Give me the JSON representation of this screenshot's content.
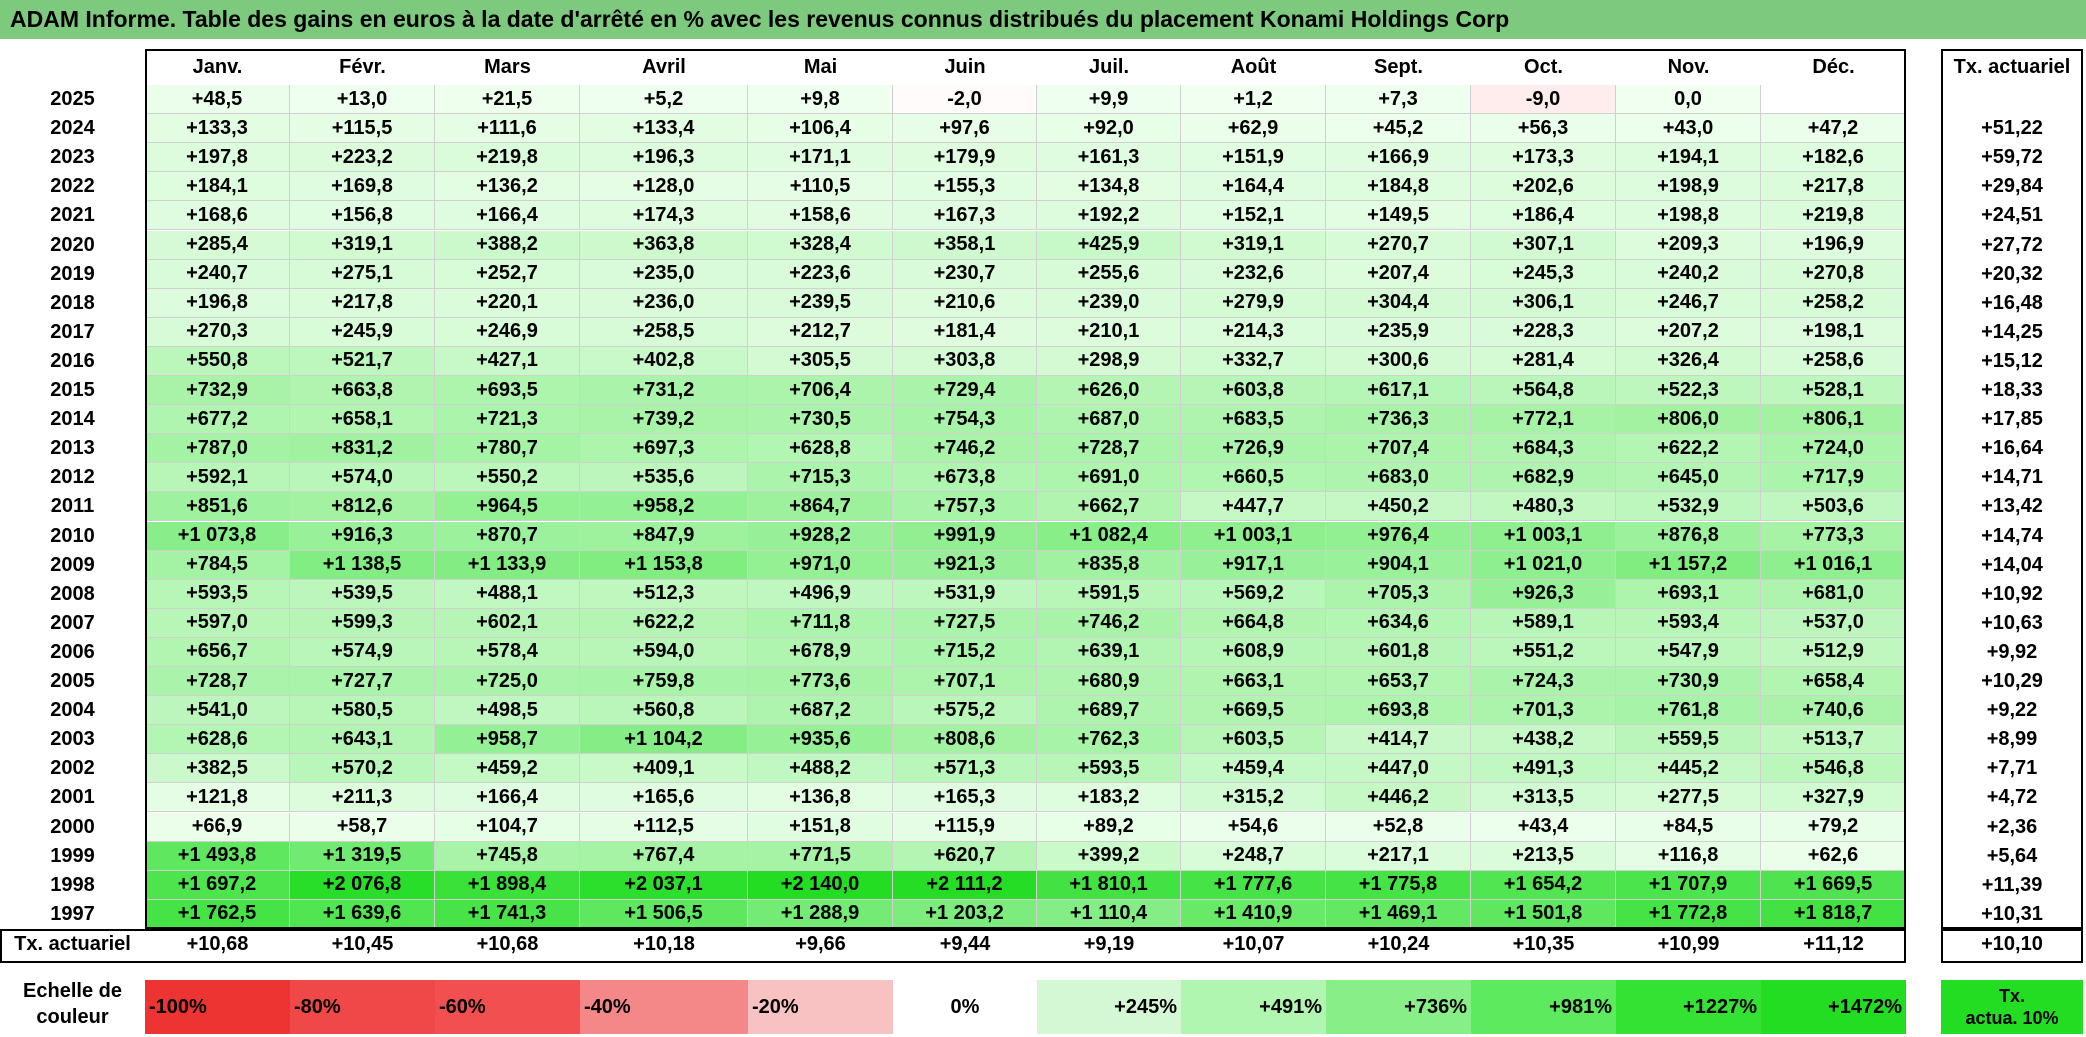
{
  "title": "ADAM Informe. Table des gains en euros à la date d'arrêté en % avec les revenus connus distribués du placement Konami Holdings Corp",
  "months": [
    "Janv.",
    "Févr.",
    "Mars",
    "Avril",
    "Mai",
    "Juin",
    "Juil.",
    "Août",
    "Sept.",
    "Oct.",
    "Nov.",
    "Déc."
  ],
  "rate_header": "Tx. actuariel",
  "bottom_row_label": "Tx. actuariel",
  "chart_data": {
    "type": "heatmap",
    "title": "ADAM Informe. Table des gains en euros à la date d'arrêté en % avec les revenus connus distribués du placement Konami Holdings Corp",
    "columns": [
      "Janv.",
      "Févr.",
      "Mars",
      "Avril",
      "Mai",
      "Juin",
      "Juil.",
      "Août",
      "Sept.",
      "Oct.",
      "Nov.",
      "Déc."
    ],
    "rows": [
      {
        "year": "2025",
        "values": [
          "+48,5",
          "+13,0",
          "+21,5",
          "+5,2",
          "+9,8",
          "-2,0",
          "+9,9",
          "+1,2",
          "+7,3",
          "-9,0",
          "0,0",
          ""
        ],
        "rate": ""
      },
      {
        "year": "2024",
        "values": [
          "+133,3",
          "+115,5",
          "+111,6",
          "+133,4",
          "+106,4",
          "+97,6",
          "+92,0",
          "+62,9",
          "+45,2",
          "+56,3",
          "+43,0",
          "+47,2"
        ],
        "rate": "+51,22"
      },
      {
        "year": "2023",
        "values": [
          "+197,8",
          "+223,2",
          "+219,8",
          "+196,3",
          "+171,1",
          "+179,9",
          "+161,3",
          "+151,9",
          "+166,9",
          "+173,3",
          "+194,1",
          "+182,6"
        ],
        "rate": "+59,72"
      },
      {
        "year": "2022",
        "values": [
          "+184,1",
          "+169,8",
          "+136,2",
          "+128,0",
          "+110,5",
          "+155,3",
          "+134,8",
          "+164,4",
          "+184,8",
          "+202,6",
          "+198,9",
          "+217,8"
        ],
        "rate": "+29,84"
      },
      {
        "year": "2021",
        "values": [
          "+168,6",
          "+156,8",
          "+166,4",
          "+174,3",
          "+158,6",
          "+167,3",
          "+192,2",
          "+152,1",
          "+149,5",
          "+186,4",
          "+198,8",
          "+219,8"
        ],
        "rate": "+24,51"
      },
      {
        "year": "2020",
        "values": [
          "+285,4",
          "+319,1",
          "+388,2",
          "+363,8",
          "+328,4",
          "+358,1",
          "+425,9",
          "+319,1",
          "+270,7",
          "+307,1",
          "+209,3",
          "+196,9"
        ],
        "rate": "+27,72"
      },
      {
        "year": "2019",
        "values": [
          "+240,7",
          "+275,1",
          "+252,7",
          "+235,0",
          "+223,6",
          "+230,7",
          "+255,6",
          "+232,6",
          "+207,4",
          "+245,3",
          "+240,2",
          "+270,8"
        ],
        "rate": "+20,32"
      },
      {
        "year": "2018",
        "values": [
          "+196,8",
          "+217,8",
          "+220,1",
          "+236,0",
          "+239,5",
          "+210,6",
          "+239,0",
          "+279,9",
          "+304,4",
          "+306,1",
          "+246,7",
          "+258,2"
        ],
        "rate": "+16,48"
      },
      {
        "year": "2017",
        "values": [
          "+270,3",
          "+245,9",
          "+246,9",
          "+258,5",
          "+212,7",
          "+181,4",
          "+210,1",
          "+214,3",
          "+235,9",
          "+228,3",
          "+207,2",
          "+198,1"
        ],
        "rate": "+14,25"
      },
      {
        "year": "2016",
        "values": [
          "+550,8",
          "+521,7",
          "+427,1",
          "+402,8",
          "+305,5",
          "+303,8",
          "+298,9",
          "+332,7",
          "+300,6",
          "+281,4",
          "+326,4",
          "+258,6"
        ],
        "rate": "+15,12"
      },
      {
        "year": "2015",
        "values": [
          "+732,9",
          "+663,8",
          "+693,5",
          "+731,2",
          "+706,4",
          "+729,4",
          "+626,0",
          "+603,8",
          "+617,1",
          "+564,8",
          "+522,3",
          "+528,1"
        ],
        "rate": "+18,33"
      },
      {
        "year": "2014",
        "values": [
          "+677,2",
          "+658,1",
          "+721,3",
          "+739,2",
          "+730,5",
          "+754,3",
          "+687,0",
          "+683,5",
          "+736,3",
          "+772,1",
          "+806,0",
          "+806,1"
        ],
        "rate": "+17,85"
      },
      {
        "year": "2013",
        "values": [
          "+787,0",
          "+831,2",
          "+780,7",
          "+697,3",
          "+628,8",
          "+746,2",
          "+728,7",
          "+726,9",
          "+707,4",
          "+684,3",
          "+622,2",
          "+724,0"
        ],
        "rate": "+16,64"
      },
      {
        "year": "2012",
        "values": [
          "+592,1",
          "+574,0",
          "+550,2",
          "+535,6",
          "+715,3",
          "+673,8",
          "+691,0",
          "+660,5",
          "+683,0",
          "+682,9",
          "+645,0",
          "+717,9"
        ],
        "rate": "+14,71"
      },
      {
        "year": "2011",
        "values": [
          "+851,6",
          "+812,6",
          "+964,5",
          "+958,2",
          "+864,7",
          "+757,3",
          "+662,7",
          "+447,7",
          "+450,2",
          "+480,3",
          "+532,9",
          "+503,6"
        ],
        "rate": "+13,42"
      },
      {
        "year": "2010",
        "values": [
          "+1 073,8",
          "+916,3",
          "+870,7",
          "+847,9",
          "+928,2",
          "+991,9",
          "+1 082,4",
          "+1 003,1",
          "+976,4",
          "+1 003,1",
          "+876,8",
          "+773,3"
        ],
        "rate": "+14,74"
      },
      {
        "year": "2009",
        "values": [
          "+784,5",
          "+1 138,5",
          "+1 133,9",
          "+1 153,8",
          "+971,0",
          "+921,3",
          "+835,8",
          "+917,1",
          "+904,1",
          "+1 021,0",
          "+1 157,2",
          "+1 016,1"
        ],
        "rate": "+14,04"
      },
      {
        "year": "2008",
        "values": [
          "+593,5",
          "+539,5",
          "+488,1",
          "+512,3",
          "+496,9",
          "+531,9",
          "+591,5",
          "+569,2",
          "+705,3",
          "+926,3",
          "+693,1",
          "+681,0"
        ],
        "rate": "+10,92"
      },
      {
        "year": "2007",
        "values": [
          "+597,0",
          "+599,3",
          "+602,1",
          "+622,2",
          "+711,8",
          "+727,5",
          "+746,2",
          "+664,8",
          "+634,6",
          "+589,1",
          "+593,4",
          "+537,0"
        ],
        "rate": "+10,63"
      },
      {
        "year": "2006",
        "values": [
          "+656,7",
          "+574,9",
          "+578,4",
          "+594,0",
          "+678,9",
          "+715,2",
          "+639,1",
          "+608,9",
          "+601,8",
          "+551,2",
          "+547,9",
          "+512,9"
        ],
        "rate": "+9,92"
      },
      {
        "year": "2005",
        "values": [
          "+728,7",
          "+727,7",
          "+725,0",
          "+759,8",
          "+773,6",
          "+707,1",
          "+680,9",
          "+663,1",
          "+653,7",
          "+724,3",
          "+730,9",
          "+658,4"
        ],
        "rate": "+10,29"
      },
      {
        "year": "2004",
        "values": [
          "+541,0",
          "+580,5",
          "+498,5",
          "+560,8",
          "+687,2",
          "+575,2",
          "+689,7",
          "+669,5",
          "+693,8",
          "+701,3",
          "+761,8",
          "+740,6"
        ],
        "rate": "+9,22"
      },
      {
        "year": "2003",
        "values": [
          "+628,6",
          "+643,1",
          "+958,7",
          "+1 104,2",
          "+935,6",
          "+808,6",
          "+762,3",
          "+603,5",
          "+414,7",
          "+438,2",
          "+559,5",
          "+513,7"
        ],
        "rate": "+8,99"
      },
      {
        "year": "2002",
        "values": [
          "+382,5",
          "+570,2",
          "+459,2",
          "+409,1",
          "+488,2",
          "+571,3",
          "+593,5",
          "+459,4",
          "+447,0",
          "+491,3",
          "+445,2",
          "+546,8"
        ],
        "rate": "+7,71"
      },
      {
        "year": "2001",
        "values": [
          "+121,8",
          "+211,3",
          "+166,4",
          "+165,6",
          "+136,8",
          "+165,3",
          "+183,2",
          "+315,2",
          "+446,2",
          "+313,5",
          "+277,5",
          "+327,9"
        ],
        "rate": "+4,72"
      },
      {
        "year": "2000",
        "values": [
          "+66,9",
          "+58,7",
          "+104,7",
          "+112,5",
          "+151,8",
          "+115,9",
          "+89,2",
          "+54,6",
          "+52,8",
          "+43,4",
          "+84,5",
          "+79,2"
        ],
        "rate": "+2,36"
      },
      {
        "year": "1999",
        "values": [
          "+1 493,8",
          "+1 319,5",
          "+745,8",
          "+767,4",
          "+771,5",
          "+620,7",
          "+399,2",
          "+248,7",
          "+217,1",
          "+213,5",
          "+116,8",
          "+62,6"
        ],
        "rate": "+5,64"
      },
      {
        "year": "1998",
        "values": [
          "+1 697,2",
          "+2 076,8",
          "+1 898,4",
          "+2 037,1",
          "+2 140,0",
          "+2 111,2",
          "+1 810,1",
          "+1 777,6",
          "+1 775,8",
          "+1 654,2",
          "+1 707,9",
          "+1 669,5"
        ],
        "rate": "+11,39"
      },
      {
        "year": "1997",
        "values": [
          "+1 762,5",
          "+1 639,6",
          "+1 741,3",
          "+1 506,5",
          "+1 288,9",
          "+1 203,2",
          "+1 110,4",
          "+1 410,9",
          "+1 469,1",
          "+1 501,8",
          "+1 772,8",
          "+1 818,7"
        ],
        "rate": "+10,31"
      }
    ],
    "monthly_rates": [
      "+10,68",
      "+10,45",
      "+10,68",
      "+10,18",
      "+9,66",
      "+9,44",
      "+9,19",
      "+10,07",
      "+10,24",
      "+10,35",
      "+10,99",
      "+11,12"
    ],
    "overall_rate": "+10,10",
    "color_scale": {
      "label_line1": "Echelle de",
      "label_line2": "couleur",
      "stops": [
        "-100%",
        "-80%",
        "-60%",
        "-40%",
        "-20%",
        "0%",
        "+245%",
        "+491%",
        "+736%",
        "+981%",
        "+1227%",
        "+1472%"
      ],
      "colors": [
        "#ee3333",
        "#f04848",
        "#f25050",
        "#f48888",
        "#f9c2c2",
        "#ffffff",
        "#d4f8d4",
        "#b0f5b0",
        "#88ee88",
        "#5eea5e",
        "#33e233",
        "#22dd22"
      ]
    },
    "legend_box": {
      "line1": "Tx.",
      "line2": "actua. 10%",
      "color": "#22dd22"
    }
  }
}
